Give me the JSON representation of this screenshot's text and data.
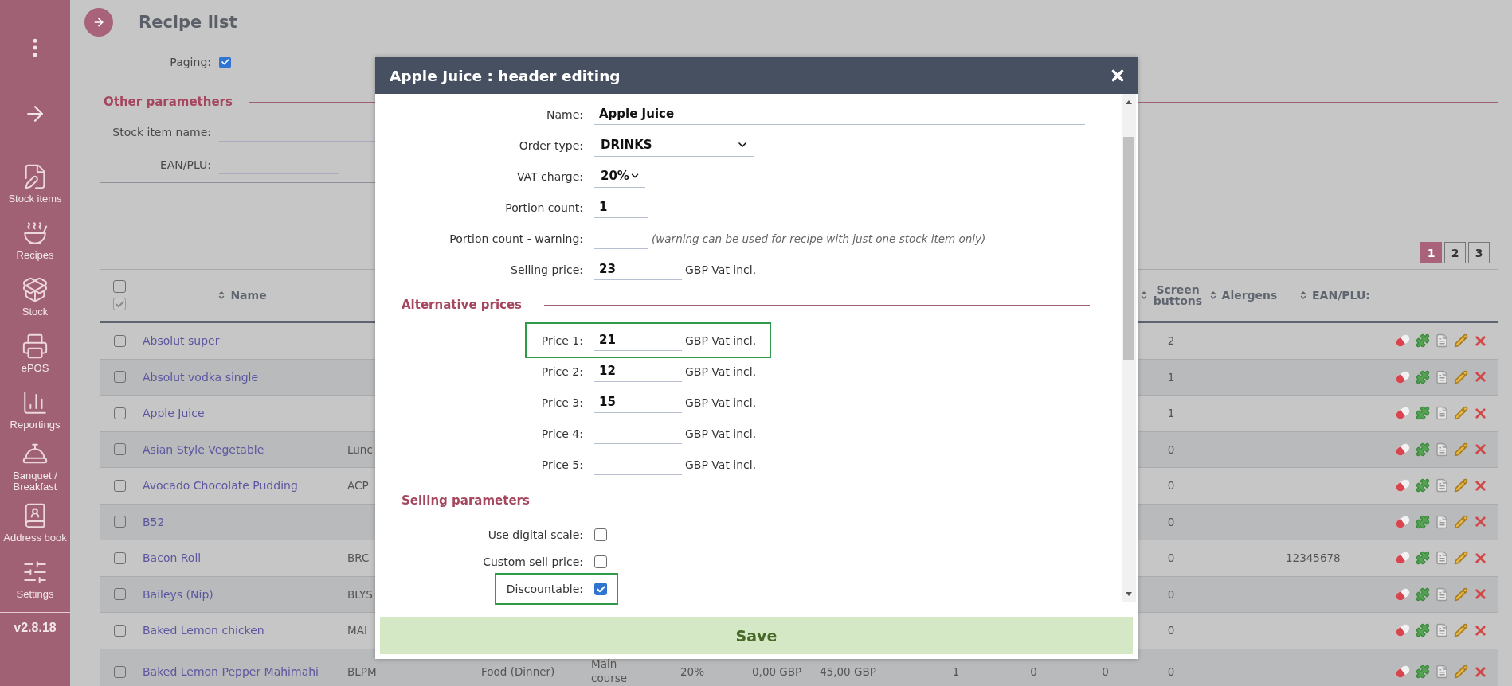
{
  "sidebar": {
    "items": [
      {
        "label": "Stock items"
      },
      {
        "label": "Recipes"
      },
      {
        "label": "Stock"
      },
      {
        "label": "ePOS"
      },
      {
        "label": "Reportings"
      },
      {
        "label": "Banquet / Breakfast"
      },
      {
        "label": "Address book"
      },
      {
        "label": "Settings"
      }
    ],
    "version": "v2.8.18"
  },
  "header": {
    "title": "Recipe list"
  },
  "filters": {
    "paging": {
      "label": "Paging:",
      "checked": true
    },
    "section_title": "Other paramethers",
    "fields": [
      {
        "label": "Stock item name:"
      },
      {
        "label": "EAN/PLU:"
      }
    ]
  },
  "pagination": [
    {
      "label": "1",
      "selected": true
    },
    {
      "label": "2",
      "selected": false
    },
    {
      "label": "3",
      "selected": false
    }
  ],
  "table": {
    "select_all": [
      {
        "checked": false
      },
      {
        "checked": true
      }
    ],
    "columns": [
      {
        "label": "Name"
      },
      {
        "label": "Screen buttons"
      },
      {
        "label": "Alergens"
      },
      {
        "label": "EAN/PLU:"
      }
    ],
    "rows": [
      {
        "checked": false,
        "name": "Absolut super",
        "screen_buttons": "2"
      },
      {
        "checked": false,
        "name": "Absolut vodka single",
        "screen_buttons": "1"
      },
      {
        "checked": false,
        "name": "Apple Juice",
        "screen_buttons": "1"
      },
      {
        "checked": false,
        "name": "Asian Style Vegetable",
        "code": "Lunc",
        "screen_buttons": "0"
      },
      {
        "checked": false,
        "name": "Avocado Chocolate Pudding",
        "code": "ACP",
        "screen_buttons": "0"
      },
      {
        "checked": false,
        "name": "B52",
        "screen_buttons": "0"
      },
      {
        "checked": false,
        "name": "Bacon Roll",
        "code": "BRC",
        "screen_buttons": "0",
        "ean": "12345678"
      },
      {
        "checked": false,
        "name": "Baileys (Nip)",
        "code": "BLYS",
        "screen_buttons": "0"
      },
      {
        "checked": false,
        "name": "Baked Lemon chicken",
        "code": "MAI",
        "screen_buttons": "0"
      },
      {
        "checked": false,
        "name": "Baked Lemon Pepper Mahimahi",
        "code": "BLPM",
        "type": "Food (Dinner)",
        "course": "Main course",
        "vat": "20%",
        "cost": "0,00 GBP",
        "price": "45,00 GBP",
        "column_9": "1",
        "column_10": "0",
        "column_11": "0",
        "screen_buttons": "0"
      }
    ]
  },
  "modal": {
    "title": "Apple Juice : header editing",
    "fields": [
      {
        "kind": "text",
        "label": "Name:",
        "value": "Apple Juice"
      },
      {
        "kind": "select",
        "label": "Order type:",
        "value": "DRINKS"
      },
      {
        "kind": "select",
        "label": "VAT charge:",
        "value": "20%"
      },
      {
        "kind": "text",
        "label": "Portion count:",
        "value": "1"
      },
      {
        "kind": "text",
        "label": "Portion count - warning:",
        "note": "(warning can be used for recipe with just one stock item only)"
      },
      {
        "kind": "text",
        "label": "Selling price:",
        "value": "23",
        "unit": "GBP Vat incl."
      }
    ],
    "sections": [
      {
        "title": "Alternative prices",
        "fields": [
          {
            "kind": "text",
            "label": "Price 1:",
            "value": "21",
            "unit": "GBP Vat incl.",
            "highlighted": true
          },
          {
            "kind": "text",
            "label": "Price 2:",
            "value": "12",
            "unit": "GBP Vat incl.",
            "highlighted": false
          },
          {
            "kind": "text",
            "label": "Price 3:",
            "value": "15",
            "unit": "GBP Vat incl.",
            "highlighted": false
          },
          {
            "kind": "text",
            "label": "Price 4:",
            "unit": "GBP Vat incl.",
            "highlighted": false
          },
          {
            "kind": "text",
            "label": "Price 5:",
            "unit": "GBP Vat incl.",
            "highlighted": false
          }
        ]
      },
      {
        "title": "Selling parameters",
        "fields": [
          {
            "kind": "checkbox",
            "label": "Use digital scale:",
            "checked": false,
            "highlighted": false
          },
          {
            "kind": "checkbox",
            "label": "Custom sell price:",
            "checked": false,
            "highlighted": false
          },
          {
            "kind": "checkbox",
            "label": "Discountable:",
            "checked": true,
            "highlighted": true
          }
        ]
      }
    ],
    "save_button": "Save"
  }
}
